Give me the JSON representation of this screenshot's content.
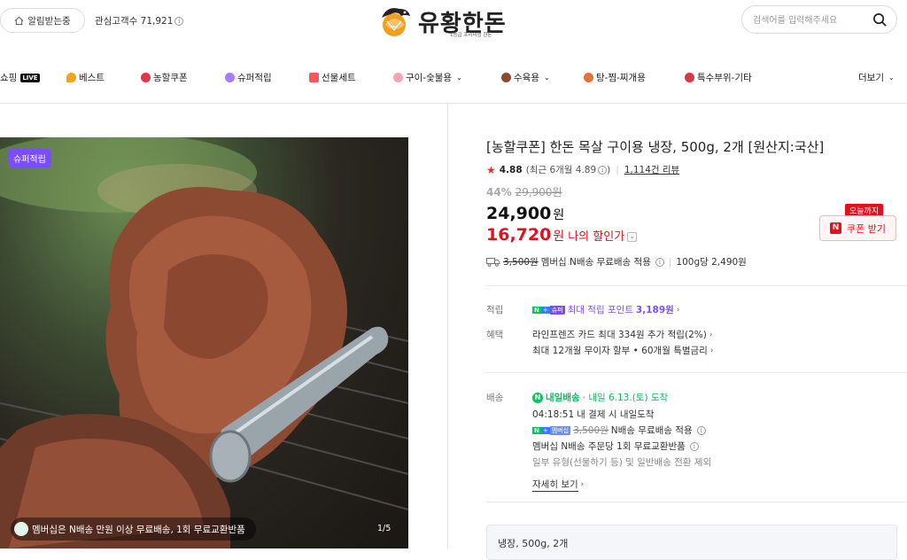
{
  "header": {
    "alarm_label": "알림받는중",
    "fav_label": "관심고객수 71,921",
    "logo_text": "유황한돈",
    "logo_sub": "1등급 프리미엄 한돈",
    "search_placeholder": "검색어를 입력해주세요"
  },
  "nav": {
    "items": [
      {
        "label": "쇼핑"
      },
      {
        "label": "베스트"
      },
      {
        "label": "농할쿠폰"
      },
      {
        "label": "슈퍼적립"
      },
      {
        "label": "선물세트"
      },
      {
        "label": "구이-숯불용"
      },
      {
        "label": "수육용"
      },
      {
        "label": "탕-찜-찌개용"
      },
      {
        "label": "특수부위-기타"
      },
      {
        "label": "더보기"
      }
    ],
    "live_badge": "LIVE"
  },
  "image": {
    "badge": "슈퍼적립",
    "caption": "멤버십은 N배송 만원 이상 무료배송, 1회 무료교환반품",
    "page": "1/5"
  },
  "product": {
    "title": "[농할쿠폰] 한돈 목살 구이용 냉장, 500g, 2개 [원산지:국산]",
    "rating": "4.88",
    "rating_recent": "(최근 6개월 4.89",
    "rating_recent_close": ")",
    "review_count": "1,114건 리뷰",
    "discount_rate": "44%",
    "original_price": "29,900원",
    "sale_price": "24,900",
    "won": "원",
    "my_price": "16,720",
    "my_price_label": "나의 할인가",
    "coupon_flag": "오늘까지",
    "coupon_label": "쿠폰 받기",
    "ship_fee": "3,500원",
    "ship_text": "멤버십 N배송 무료배송 적용",
    "unit_price": "100g당 2,490원"
  },
  "benefits": {
    "point_label": "적립",
    "point_badge_a": "N",
    "point_badge_b": "+",
    "point_badge_c": "슈퍼",
    "point_text": "최대 적립 포인트",
    "point_value": "3,189원",
    "benefit_label": "혜택",
    "benefit_line1": "라인프렌즈 카드 최대 334원 추가 적립(2%)",
    "benefit_line2": "최대 12개월 무이자 할부 • 60개월 특별금리"
  },
  "delivery": {
    "label": "배송",
    "n_badge": "N",
    "express": "내일배송",
    "date": "· 내일 6.13.(토) 도착",
    "countdown": "04:18:51",
    "countdown_text": "내 결제 시 내일도착",
    "badge_a": "N",
    "badge_b": "+",
    "badge_c": "멤버십",
    "fee": "3,500원",
    "fee_text": "N배송 무료배송 적용",
    "line3": "멤버십 N배송 주문당 1회 무료교환반품",
    "line4": "일부 유형(선물하기 등) 및 일반배송 전환 제외",
    "more": "자세히 보기"
  },
  "option": {
    "selected": "냉장, 500g, 2개"
  },
  "colors": {
    "accent_red": "#e0121e",
    "naver_green": "#03c75a",
    "purple": "#7c4dff"
  }
}
